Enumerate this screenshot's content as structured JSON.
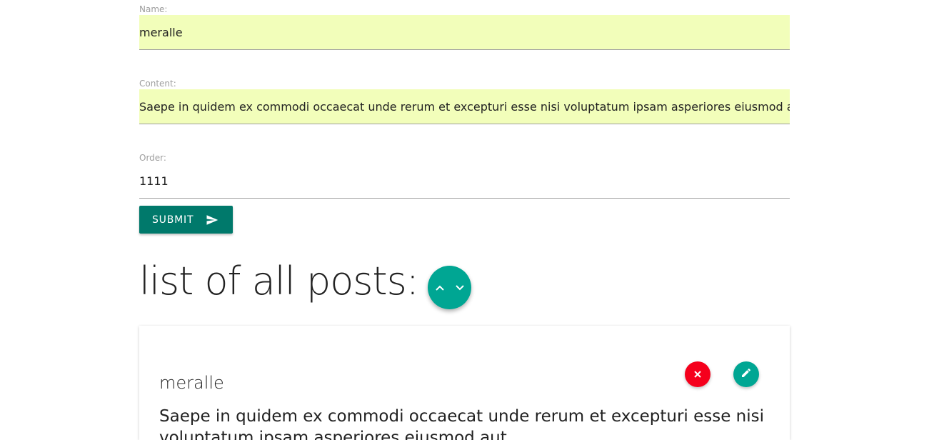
{
  "form": {
    "name_label": "Name:",
    "name_value": "meralle",
    "content_label": "Content:",
    "content_value": "Saepe in quidem ex commodi occaecat unde rerum et excepturi esse nisi voluptatum ipsam asperiores eiusmod aut",
    "order_label": "Order:",
    "order_value": "1111",
    "submit_label": "SUBMIT",
    "submit_icon": "send-icon"
  },
  "list": {
    "title": "list of all posts:",
    "sort_icons": [
      "chevron-up-icon",
      "chevron-down-icon"
    ]
  },
  "posts": [
    {
      "name": "meralle",
      "content": "Saepe in quidem ex commodi occaecat unde rerum et excepturi esse nisi voluptatum ipsam asperiores eiusmod aut",
      "delete_icon": "close-icon",
      "edit_icon": "pencil-icon"
    }
  ],
  "colors": {
    "filled_input_bg": "#f2feba",
    "submit_bg": "#00796b",
    "fab_bg": "#00a693",
    "delete_bg": "#f5001c",
    "edit_bg": "#00a693"
  }
}
